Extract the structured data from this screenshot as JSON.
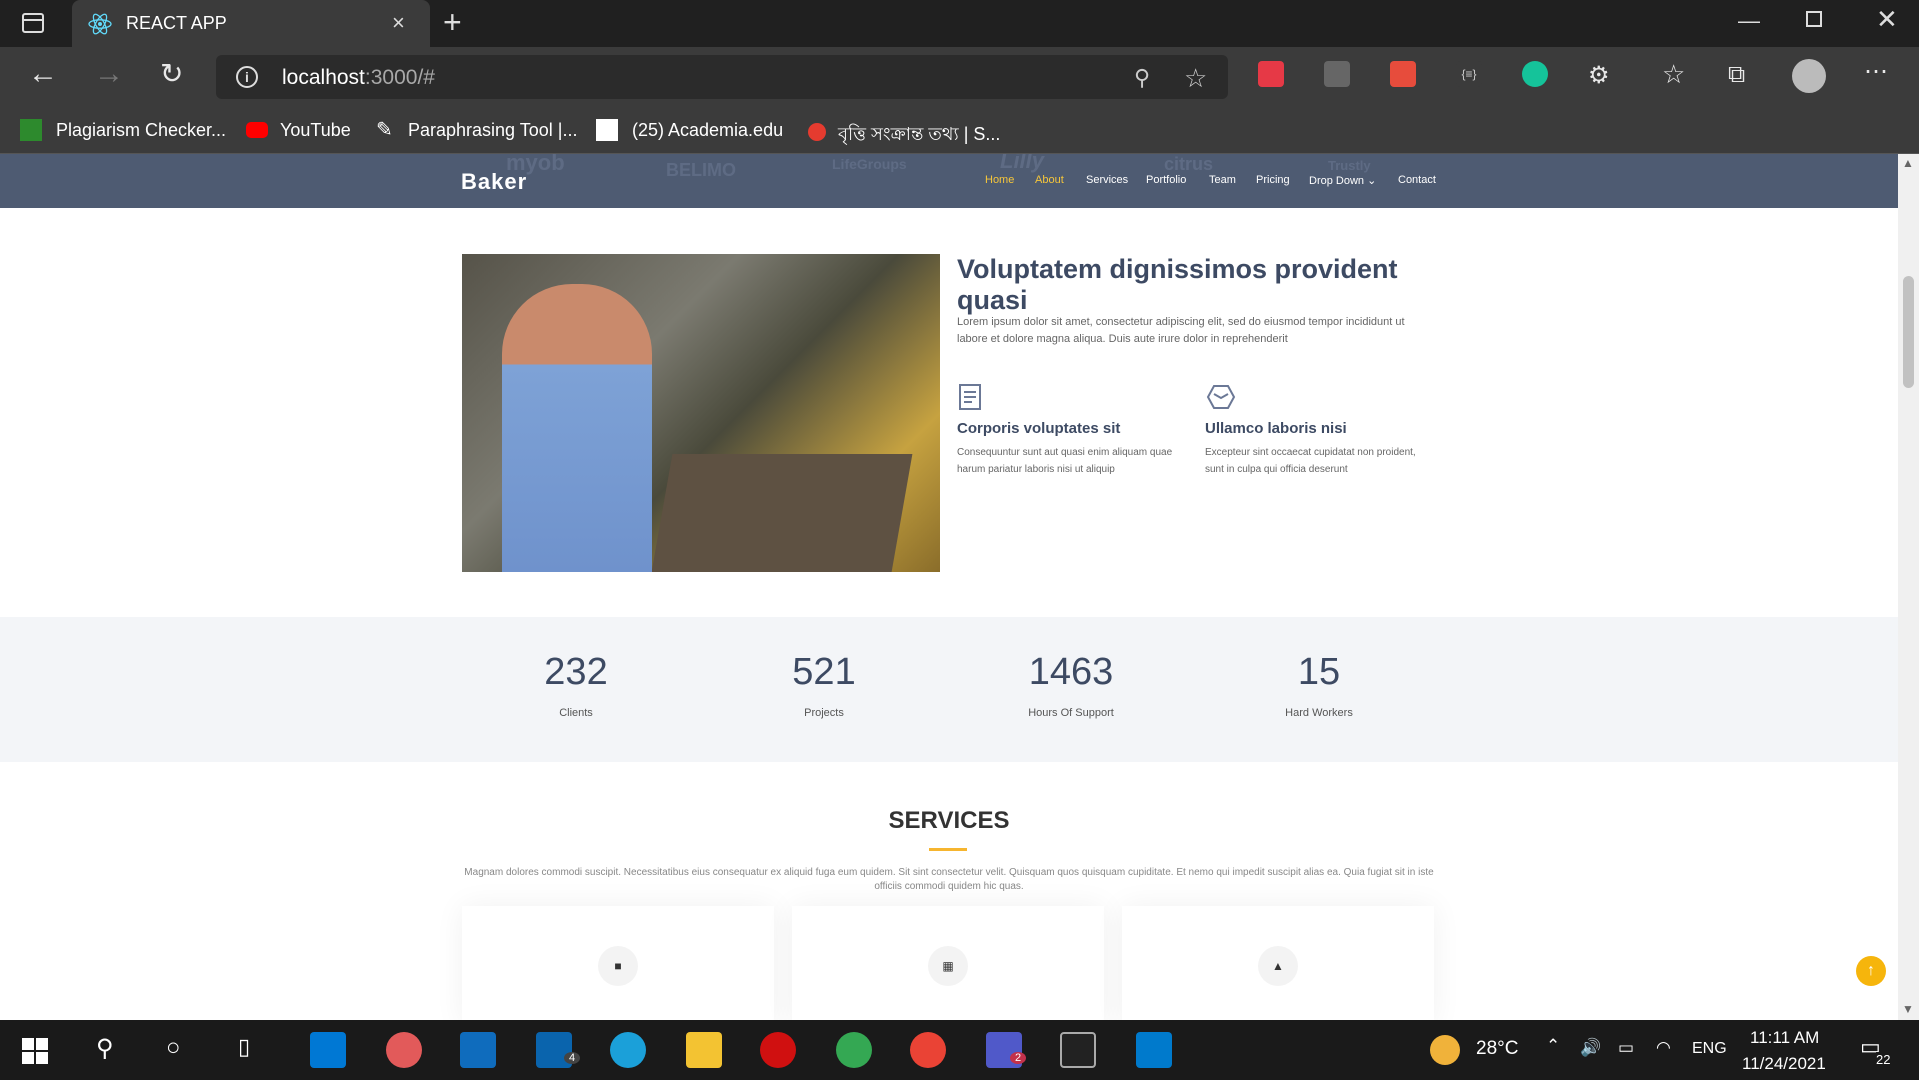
{
  "browser": {
    "tab_title": "REACT APP",
    "tab_close": "×",
    "new_tab": "+",
    "url_host": "localhost",
    "url_path": ":3000/#"
  },
  "bookmarks": [
    "Plagiarism Checker...",
    "YouTube",
    "Paraphrasing Tool |...",
    "(25) Academia.edu",
    "বৃত্তি সংক্রান্ত তথ্য | S..."
  ],
  "header": {
    "brand": "Baker",
    "nav": [
      "Home",
      "About",
      "Services",
      "Portfolio",
      "Team",
      "Pricing",
      "Drop Down",
      "Contact"
    ],
    "dropdown_chevron": "⌄",
    "client_logos": [
      "myob",
      "BELIMO",
      "LifeGroups",
      "Lilly",
      "citrus",
      "Trustly"
    ]
  },
  "about": {
    "title": "Voluptatem dignissimos provident quasi",
    "text": "Lorem ipsum dolor sit amet, consectetur adipiscing elit, sed do eiusmod tempor incididunt ut labore et dolore magna aliqua. Duis aute irure dolor in reprehenderit",
    "features": [
      {
        "title": "Corporis voluptates sit",
        "text": "Consequuntur sunt aut quasi enim aliquam quae harum pariatur laboris nisi ut aliquip",
        "icon": "receipt-icon"
      },
      {
        "title": "Ullamco laboris nisi",
        "text": "Excepteur sint occaecat cupidatat non proident, sunt in culpa qui officia deserunt",
        "icon": "cube-icon"
      }
    ]
  },
  "counts": [
    {
      "value": "232",
      "label": "Clients"
    },
    {
      "value": "521",
      "label": "Projects"
    },
    {
      "value": "1463",
      "label": "Hours Of Support"
    },
    {
      "value": "15",
      "label": "Hard Workers"
    }
  ],
  "services": {
    "title": "SERVICES",
    "desc": "Magnam dolores commodi suscipit. Necessitatibus eius consequatur ex aliquid fuga eum quidem. Sit sint consectetur velit. Quisquam quos quisquam cupiditate. Et nemo qui impedit suscipit alias ea. Quia fugiat sit in iste officiis commodi quidem hic quas.",
    "card_icons": [
      "briefcase-icon",
      "qr-icon",
      "lock-icon"
    ]
  },
  "taskbar": {
    "temperature": "28°C",
    "language": "ENG",
    "time": "11:11 AM",
    "date": "11/24/2021",
    "notifications": "22",
    "mail_badge": "4",
    "teams_badge": "2"
  },
  "colors": {
    "accent": "#f6c63a",
    "header_bg": "#4e5b72",
    "title": "#3d4a63"
  }
}
